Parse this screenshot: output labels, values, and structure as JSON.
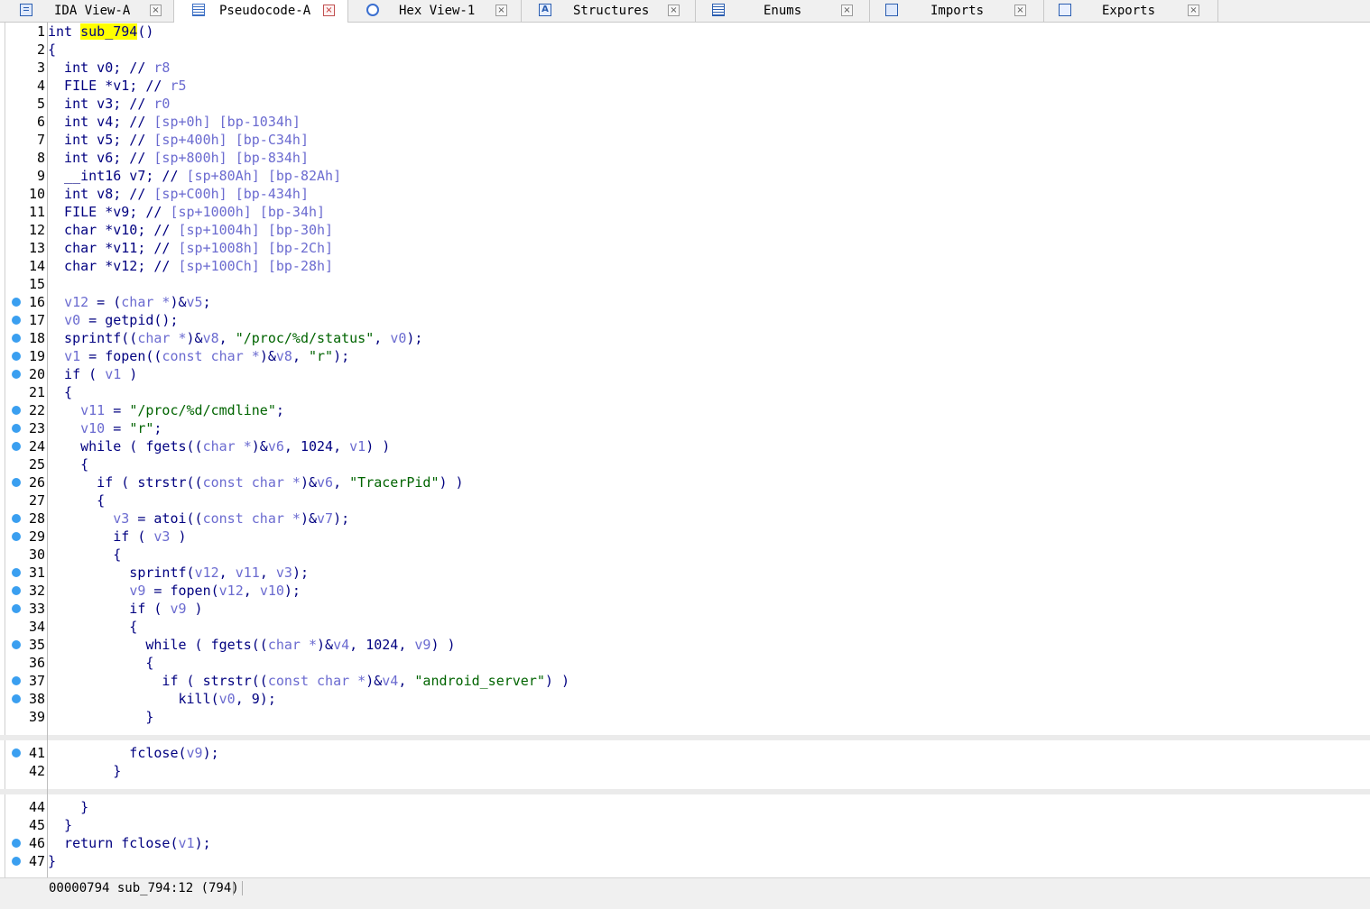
{
  "tabs": [
    {
      "label": "IDA View-A",
      "icon": "grid-icon",
      "active": false
    },
    {
      "label": "Pseudocode-A",
      "icon": "document-icon",
      "active": true
    },
    {
      "label": "Hex View-1",
      "icon": "hex-icon",
      "active": false
    },
    {
      "label": "Structures",
      "icon": "structure-icon",
      "active": false
    },
    {
      "label": "Enums",
      "icon": "enum-icon",
      "active": false
    },
    {
      "label": "Imports",
      "icon": "imports-icon",
      "active": false
    },
    {
      "label": "Exports",
      "icon": "exports-icon",
      "active": false
    }
  ],
  "close_glyph": "×",
  "colors": {
    "keyword": "#000080",
    "variable": "#6b6bd0",
    "string": "#006400",
    "highlight": "#ffff00",
    "breakpoint_dot": "#3a9ff0"
  },
  "code_lines": [
    {
      "n": "1",
      "dot": false,
      "tokens": [
        [
          "kw",
          "int "
        ],
        [
          "hl",
          "sub_794"
        ],
        [
          "plain",
          "()"
        ]
      ]
    },
    {
      "n": "2",
      "dot": false,
      "tokens": [
        [
          "plain",
          "{"
        ]
      ]
    },
    {
      "n": "3",
      "dot": false,
      "tokens": [
        [
          "kw",
          "  int v0; // "
        ],
        [
          "var",
          "r8"
        ]
      ]
    },
    {
      "n": "4",
      "dot": false,
      "tokens": [
        [
          "kw",
          "  FILE *v1; // "
        ],
        [
          "var",
          "r5"
        ]
      ]
    },
    {
      "n": "5",
      "dot": false,
      "tokens": [
        [
          "kw",
          "  int v3; // "
        ],
        [
          "var",
          "r0"
        ]
      ]
    },
    {
      "n": "6",
      "dot": false,
      "tokens": [
        [
          "kw",
          "  int v4; // "
        ],
        [
          "var",
          "[sp+0h] [bp-1034h]"
        ]
      ]
    },
    {
      "n": "7",
      "dot": false,
      "tokens": [
        [
          "kw",
          "  int v5; // "
        ],
        [
          "var",
          "[sp+400h] [bp-C34h]"
        ]
      ]
    },
    {
      "n": "8",
      "dot": false,
      "tokens": [
        [
          "kw",
          "  int v6; // "
        ],
        [
          "var",
          "[sp+800h] [bp-834h]"
        ]
      ]
    },
    {
      "n": "9",
      "dot": false,
      "tokens": [
        [
          "kw",
          "  __int16 v7; // "
        ],
        [
          "var",
          "[sp+80Ah] [bp-82Ah]"
        ]
      ]
    },
    {
      "n": "10",
      "dot": false,
      "tokens": [
        [
          "kw",
          "  int v8; // "
        ],
        [
          "var",
          "[sp+C00h] [bp-434h]"
        ]
      ]
    },
    {
      "n": "11",
      "dot": false,
      "tokens": [
        [
          "kw",
          "  FILE *v9; // "
        ],
        [
          "var",
          "[sp+1000h] [bp-34h]"
        ]
      ]
    },
    {
      "n": "12",
      "dot": false,
      "tokens": [
        [
          "kw",
          "  char *v10; // "
        ],
        [
          "var",
          "[sp+1004h] [bp-30h]"
        ]
      ]
    },
    {
      "n": "13",
      "dot": false,
      "tokens": [
        [
          "kw",
          "  char *v11; // "
        ],
        [
          "var",
          "[sp+1008h] [bp-2Ch]"
        ]
      ]
    },
    {
      "n": "14",
      "dot": false,
      "tokens": [
        [
          "kw",
          "  char *v12; // "
        ],
        [
          "var",
          "[sp+100Ch] [bp-28h]"
        ]
      ]
    },
    {
      "n": "15",
      "dot": false,
      "tokens": []
    },
    {
      "n": "16",
      "dot": true,
      "tokens": [
        [
          "plain",
          "  "
        ],
        [
          "var",
          "v12"
        ],
        [
          "plain",
          " = ("
        ],
        [
          "var",
          "char *"
        ],
        [
          "plain",
          ")&"
        ],
        [
          "var",
          "v5"
        ],
        [
          "plain",
          ";"
        ]
      ]
    },
    {
      "n": "17",
      "dot": true,
      "tokens": [
        [
          "plain",
          "  "
        ],
        [
          "var",
          "v0"
        ],
        [
          "plain",
          " = getpid();"
        ]
      ]
    },
    {
      "n": "18",
      "dot": true,
      "tokens": [
        [
          "plain",
          "  sprintf(("
        ],
        [
          "var",
          "char *"
        ],
        [
          "plain",
          ")&"
        ],
        [
          "var",
          "v8"
        ],
        [
          "plain",
          ", "
        ],
        [
          "str",
          "\"/proc/%d/status\""
        ],
        [
          "plain",
          ", "
        ],
        [
          "var",
          "v0"
        ],
        [
          "plain",
          ");"
        ]
      ]
    },
    {
      "n": "19",
      "dot": true,
      "tokens": [
        [
          "plain",
          "  "
        ],
        [
          "var",
          "v1"
        ],
        [
          "plain",
          " = fopen(("
        ],
        [
          "var",
          "const char *"
        ],
        [
          "plain",
          ")&"
        ],
        [
          "var",
          "v8"
        ],
        [
          "plain",
          ", "
        ],
        [
          "str",
          "\"r\""
        ],
        [
          "plain",
          ");"
        ]
      ]
    },
    {
      "n": "20",
      "dot": true,
      "tokens": [
        [
          "plain",
          "  if ( "
        ],
        [
          "var",
          "v1"
        ],
        [
          "plain",
          " )"
        ]
      ]
    },
    {
      "n": "21",
      "dot": false,
      "tokens": [
        [
          "plain",
          "  {"
        ]
      ]
    },
    {
      "n": "22",
      "dot": true,
      "tokens": [
        [
          "plain",
          "    "
        ],
        [
          "var",
          "v11"
        ],
        [
          "plain",
          " = "
        ],
        [
          "str",
          "\"/proc/%d/cmdline\""
        ],
        [
          "plain",
          ";"
        ]
      ]
    },
    {
      "n": "23",
      "dot": true,
      "tokens": [
        [
          "plain",
          "    "
        ],
        [
          "var",
          "v10"
        ],
        [
          "plain",
          " = "
        ],
        [
          "str",
          "\"r\""
        ],
        [
          "plain",
          ";"
        ]
      ]
    },
    {
      "n": "24",
      "dot": true,
      "tokens": [
        [
          "plain",
          "    while ( fgets(("
        ],
        [
          "var",
          "char *"
        ],
        [
          "plain",
          ")&"
        ],
        [
          "var",
          "v6"
        ],
        [
          "plain",
          ", 1024, "
        ],
        [
          "var",
          "v1"
        ],
        [
          "plain",
          ") )"
        ]
      ]
    },
    {
      "n": "25",
      "dot": false,
      "tokens": [
        [
          "plain",
          "    {"
        ]
      ]
    },
    {
      "n": "26",
      "dot": true,
      "tokens": [
        [
          "plain",
          "      if ( strstr(("
        ],
        [
          "var",
          "const char *"
        ],
        [
          "plain",
          ")&"
        ],
        [
          "var",
          "v6"
        ],
        [
          "plain",
          ", "
        ],
        [
          "str",
          "\"TracerPid\""
        ],
        [
          "plain",
          ") )"
        ]
      ]
    },
    {
      "n": "27",
      "dot": false,
      "tokens": [
        [
          "plain",
          "      {"
        ]
      ]
    },
    {
      "n": "28",
      "dot": true,
      "tokens": [
        [
          "plain",
          "        "
        ],
        [
          "var",
          "v3"
        ],
        [
          "plain",
          " = atoi(("
        ],
        [
          "var",
          "const char *"
        ],
        [
          "plain",
          ")&"
        ],
        [
          "var",
          "v7"
        ],
        [
          "plain",
          ");"
        ]
      ]
    },
    {
      "n": "29",
      "dot": true,
      "tokens": [
        [
          "plain",
          "        if ( "
        ],
        [
          "var",
          "v3"
        ],
        [
          "plain",
          " )"
        ]
      ]
    },
    {
      "n": "30",
      "dot": false,
      "tokens": [
        [
          "plain",
          "        {"
        ]
      ]
    },
    {
      "n": "31",
      "dot": true,
      "tokens": [
        [
          "plain",
          "          sprintf("
        ],
        [
          "var",
          "v12"
        ],
        [
          "plain",
          ", "
        ],
        [
          "var",
          "v11"
        ],
        [
          "plain",
          ", "
        ],
        [
          "var",
          "v3"
        ],
        [
          "plain",
          ");"
        ]
      ]
    },
    {
      "n": "32",
      "dot": true,
      "tokens": [
        [
          "plain",
          "          "
        ],
        [
          "var",
          "v9"
        ],
        [
          "plain",
          " = fopen("
        ],
        [
          "var",
          "v12"
        ],
        [
          "plain",
          ", "
        ],
        [
          "var",
          "v10"
        ],
        [
          "plain",
          ");"
        ]
      ]
    },
    {
      "n": "33",
      "dot": true,
      "tokens": [
        [
          "plain",
          "          if ( "
        ],
        [
          "var",
          "v9"
        ],
        [
          "plain",
          " )"
        ]
      ]
    },
    {
      "n": "34",
      "dot": false,
      "tokens": [
        [
          "plain",
          "          {"
        ]
      ]
    },
    {
      "n": "35",
      "dot": true,
      "tokens": [
        [
          "plain",
          "            while ( fgets(("
        ],
        [
          "var",
          "char *"
        ],
        [
          "plain",
          ")&"
        ],
        [
          "var",
          "v4"
        ],
        [
          "plain",
          ", 1024, "
        ],
        [
          "var",
          "v9"
        ],
        [
          "plain",
          ") )"
        ]
      ]
    },
    {
      "n": "36",
      "dot": false,
      "tokens": [
        [
          "plain",
          "            {"
        ]
      ]
    },
    {
      "n": "37",
      "dot": true,
      "tokens": [
        [
          "plain",
          "              if ( strstr(("
        ],
        [
          "var",
          "const char *"
        ],
        [
          "plain",
          ")&"
        ],
        [
          "var",
          "v4"
        ],
        [
          "plain",
          ", "
        ],
        [
          "str",
          "\"android_server\""
        ],
        [
          "plain",
          ") )"
        ]
      ]
    },
    {
      "n": "38",
      "dot": true,
      "tokens": [
        [
          "plain",
          "                kill("
        ],
        [
          "var",
          "v0"
        ],
        [
          "plain",
          ", 9);"
        ]
      ]
    },
    {
      "n": "39",
      "dot": false,
      "tokens": [
        [
          "plain",
          "            }"
        ]
      ]
    },
    {
      "n": "41",
      "dot": true,
      "tokens": [
        [
          "plain",
          "          fclose("
        ],
        [
          "var",
          "v9"
        ],
        [
          "plain",
          ");"
        ]
      ]
    },
    {
      "n": "42",
      "dot": false,
      "tokens": [
        [
          "plain",
          "        }"
        ]
      ]
    },
    {
      "n": "44",
      "dot": false,
      "tokens": [
        [
          "plain",
          "    }"
        ]
      ]
    },
    {
      "n": "45",
      "dot": false,
      "tokens": [
        [
          "plain",
          "  }"
        ]
      ]
    },
    {
      "n": "46",
      "dot": true,
      "tokens": [
        [
          "plain",
          "  return fclose("
        ],
        [
          "var",
          "v1"
        ],
        [
          "plain",
          ");"
        ]
      ]
    },
    {
      "n": "47",
      "dot": true,
      "tokens": [
        [
          "plain",
          "}"
        ]
      ]
    }
  ],
  "status": {
    "text": "00000794 sub_794:12 (794)"
  }
}
